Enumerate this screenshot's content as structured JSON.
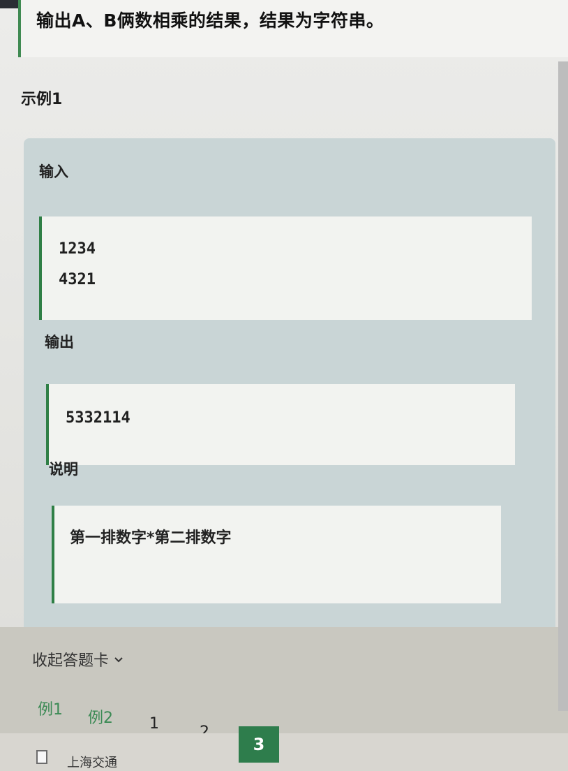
{
  "problem": {
    "output_desc": "输出A、B俩数相乘的结果，结果为字符串。"
  },
  "example": {
    "title": "示例1",
    "input_label": "输入",
    "input_lines": [
      "1234",
      "4321"
    ],
    "output_label": "输出",
    "output_value": "5332114",
    "explain_label": "说明",
    "explain_text": "第一排数字*第二排数字"
  },
  "answer_card": {
    "collapse_label": "收起答题卡",
    "nav": {
      "examples": [
        "例1",
        "例2"
      ],
      "numbers": [
        "1",
        "2"
      ],
      "current": "3"
    }
  },
  "taskbar": {
    "file_label": "上海交通"
  },
  "colors": {
    "accent": "#2e7d4c",
    "panel": "#c9d5d6",
    "code_bg": "#f2f3f0"
  },
  "icons": [
    "file-icon",
    "chevron-down-icon",
    "cursor-icon"
  ]
}
